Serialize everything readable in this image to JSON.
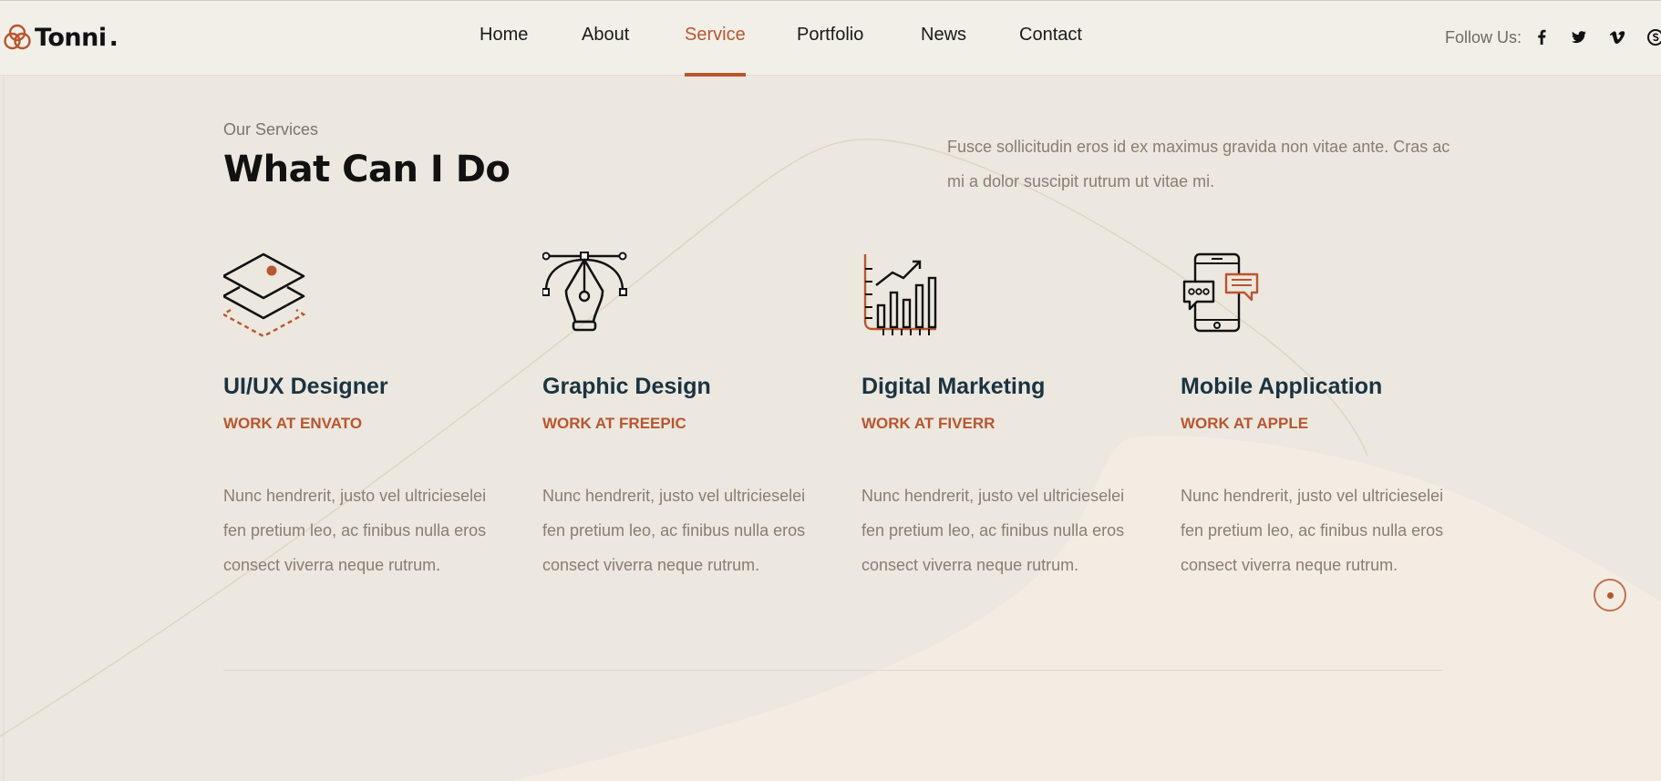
{
  "brand": {
    "name": "Tonni",
    "dot": "."
  },
  "nav": {
    "items": [
      {
        "label": "Home",
        "active": false
      },
      {
        "label": "About",
        "active": false
      },
      {
        "label": "Service",
        "active": true
      },
      {
        "label": "Portfolio",
        "active": false
      },
      {
        "label": "News",
        "active": false
      },
      {
        "label": "Contact",
        "active": false
      }
    ]
  },
  "follow": {
    "label": "Follow Us:",
    "icons": [
      "facebook-icon",
      "twitter-icon",
      "vimeo-icon",
      "skype-icon"
    ]
  },
  "section": {
    "eyebrow": "Our Services",
    "title": "What Can I Do",
    "intro": "Fusce sollicitudin eros id ex maximus gravida non vitae ante. Cras ac mi a dolor suscipit rutrum ut vitae mi."
  },
  "services": [
    {
      "icon": "layers-icon",
      "title": "UI/UX Designer",
      "sub": "WORK AT ENVATO",
      "text": "Nunc hendrerit, justo vel ultricieselei fen pretium leo, ac finibus nulla eros consect viverra neque rutrum."
    },
    {
      "icon": "pen-tool-icon",
      "title": "Graphic Design",
      "sub": "WORK AT FREEPIC",
      "text": "Nunc hendrerit, justo vel ultricieselei fen pretium leo, ac finibus nulla eros consect viverra neque rutrum."
    },
    {
      "icon": "bar-chart-icon",
      "title": "Digital Marketing",
      "sub": "WORK AT FIVERR",
      "text": "Nunc hendrerit, justo vel ultricieselei fen pretium leo, ac finibus nulla eros consect viverra neque rutrum."
    },
    {
      "icon": "mobile-chat-icon",
      "title": "Mobile Application",
      "sub": "WORK AT APPLE",
      "text": "Nunc hendrerit, justo vel ultricieselei fen pretium leo, ac finibus nulla eros consect viverra neque rutrum."
    }
  ],
  "colors": {
    "accent": "#b8562f",
    "heading": "#1a3340",
    "body": "#8a7d73",
    "background": "#ece7df"
  }
}
